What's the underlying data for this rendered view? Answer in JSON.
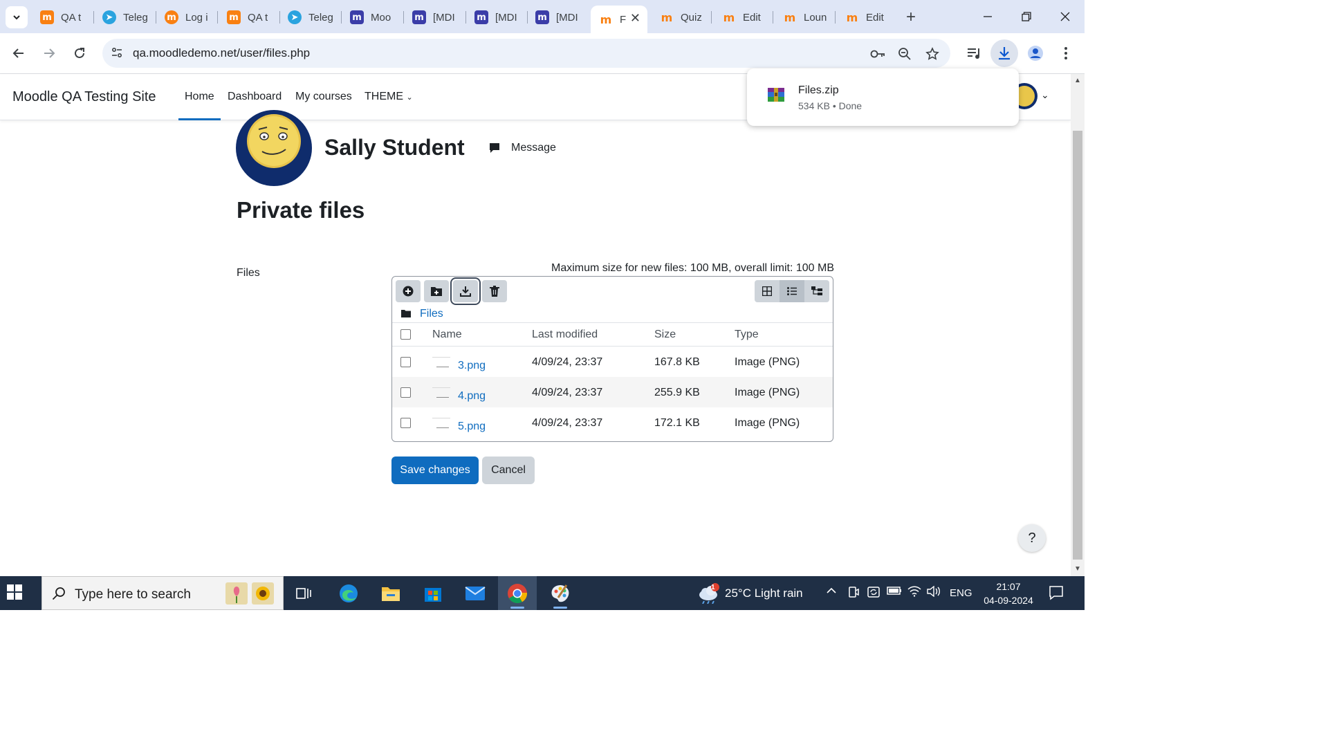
{
  "browser": {
    "tabs": [
      {
        "title": "QA t",
        "favicon": "moodle-orange"
      },
      {
        "title": "Teleg",
        "favicon": "telegram"
      },
      {
        "title": "Log i",
        "favicon": "login"
      },
      {
        "title": "QA t",
        "favicon": "moodle-orange"
      },
      {
        "title": "Teleg",
        "favicon": "telegram"
      },
      {
        "title": "Moo",
        "favicon": "moodle-purple"
      },
      {
        "title": "[MDI",
        "favicon": "moodle-purple"
      },
      {
        "title": "[MDI",
        "favicon": "moodle-purple"
      },
      {
        "title": "[MDI",
        "favicon": "moodle-purple"
      },
      {
        "title": "F",
        "favicon": "moodle-outline",
        "active": true
      },
      {
        "title": "Quiz",
        "favicon": "moodle-outline"
      },
      {
        "title": "Edit",
        "favicon": "moodle-outline"
      },
      {
        "title": "Loun",
        "favicon": "moodle-outline"
      },
      {
        "title": "Edit",
        "favicon": "moodle-outline"
      }
    ],
    "url": "qa.moodledemo.net/user/files.php",
    "download": {
      "filename": "Files.zip",
      "meta": "534 KB • Done"
    }
  },
  "moodle": {
    "site_name": "Moodle QA Testing Site",
    "nav": [
      "Home",
      "Dashboard",
      "My courses",
      "THEME"
    ],
    "active_nav": "Home",
    "user_name": "Sally Student",
    "message_label": "Message",
    "page_title": "Private files",
    "files_label": "Files",
    "max_size_text": "Maximum size for new files: 100 MB, overall limit: 100 MB",
    "path_label": "Files",
    "columns": [
      "Name",
      "Last modified",
      "Size",
      "Type"
    ],
    "files": [
      {
        "name": "3.png",
        "modified": "4/09/24, 23:37",
        "size": "167.8 KB",
        "type": "Image (PNG)"
      },
      {
        "name": "4.png",
        "modified": "4/09/24, 23:37",
        "size": "255.9 KB",
        "type": "Image (PNG)"
      },
      {
        "name": "5.png",
        "modified": "4/09/24, 23:37",
        "size": "172.1 KB",
        "type": "Image (PNG)"
      }
    ],
    "save_label": "Save changes",
    "cancel_label": "Cancel",
    "help_label": "?"
  },
  "taskbar": {
    "search_placeholder": "Type here to search",
    "weather": "25°C  Light rain",
    "weather_badge": "1",
    "language": "ENG",
    "time": "21:07",
    "date": "04-09-2024"
  },
  "colors": {
    "accent": "#0f6cbf",
    "taskbar": "#1f2f45",
    "tabstrip": "#dfe6f6"
  }
}
